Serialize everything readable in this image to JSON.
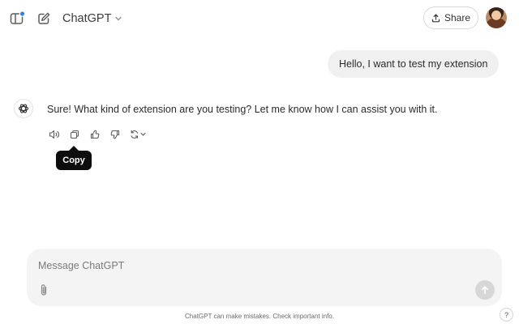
{
  "header": {
    "model_name": "ChatGPT",
    "share_label": "Share",
    "sidebar_icon": "sidebar-toggle-icon",
    "new_chat_icon": "new-chat-icon",
    "notification_dot_color": "#2f7ff5"
  },
  "conversation": {
    "user_message": "Hello, I want to test my extension",
    "assistant_message": "Sure! What kind of extension are you testing? Let me know how I can assist you with it.",
    "actions": [
      {
        "name": "read-aloud",
        "icon": "speaker-icon"
      },
      {
        "name": "copy",
        "icon": "copy-icon"
      },
      {
        "name": "good-response",
        "icon": "thumbs-up-icon"
      },
      {
        "name": "bad-response",
        "icon": "thumbs-down-icon"
      },
      {
        "name": "regenerate",
        "icon": "refresh-icon"
      }
    ],
    "tooltip": "Copy"
  },
  "composer": {
    "placeholder": "Message ChatGPT",
    "value": ""
  },
  "footer": {
    "disclaimer": "ChatGPT can make mistakes. Check important info.",
    "help_label": "?"
  }
}
